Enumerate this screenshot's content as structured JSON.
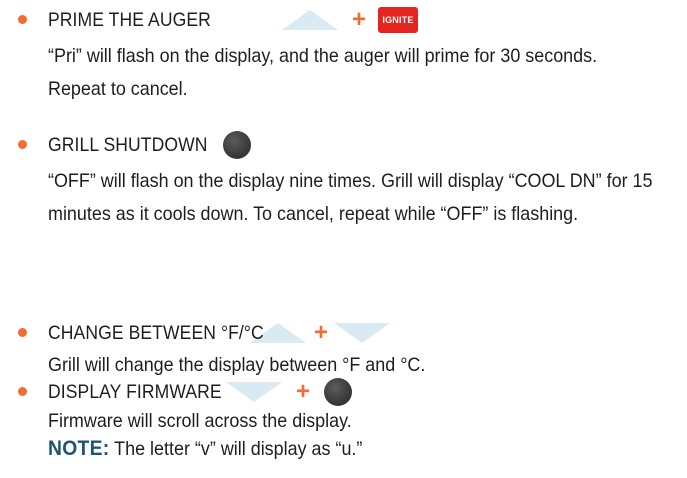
{
  "items": [
    {
      "heading": "PRIME THE AUGER",
      "ignite_label": "IGNITE",
      "body": "“Pri” will flash on the display, and the auger will prime for 30 seconds. Repeat to cancel."
    },
    {
      "heading": "GRILL SHUTDOWN",
      "body": "“OFF” will flash on the display nine times. Grill will display “COOL DN” for 15 minutes as it cools down. To cancel, repeat while “OFF” is flashing."
    },
    {
      "heading": "CHANGE BETWEEN °F/°C",
      "body": "Grill will change the display between °F and °C."
    },
    {
      "heading": "DISPLAY FIRMWARE",
      "body": "Firmware will scroll across the display.",
      "note_label": "NOTE:",
      "note_text": "The letter “v” will display as “u.”"
    }
  ],
  "plus_symbol": "+",
  "colors": {
    "bullet": "#f26b32",
    "plus": "#f26b32",
    "ignite_bg": "#e52620",
    "arrow": "#d9eaf3",
    "knob": "#3c3c3c",
    "note": "#1f5573"
  }
}
